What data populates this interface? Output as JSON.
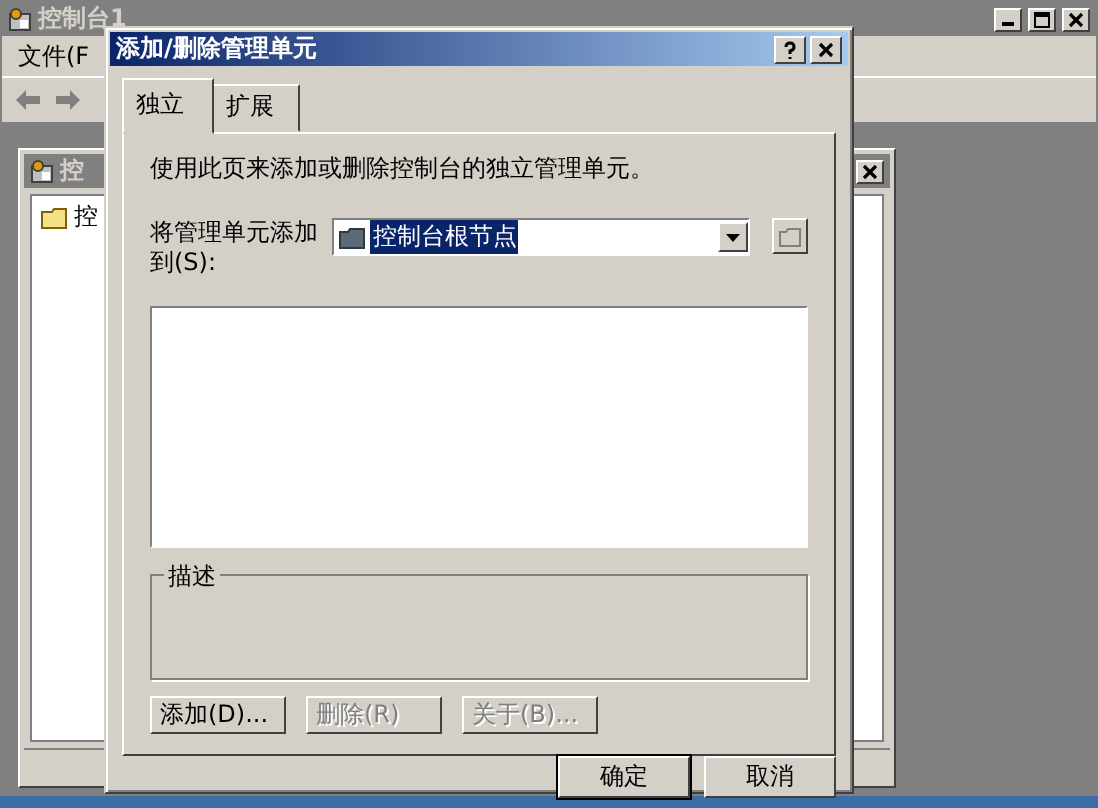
{
  "background_window": {
    "title": "控制台1",
    "menu": [
      {
        "label": "文件(F"
      }
    ],
    "child_window": {
      "title": "控",
      "tree": [
        {
          "label": "控"
        }
      ]
    }
  },
  "dialog": {
    "title": "添加/删除管理单元",
    "tabs": [
      {
        "label": "独立",
        "selected": true
      },
      {
        "label": "扩展",
        "selected": false
      }
    ],
    "description": "使用此页来添加或删除控制台的独立管理单元。",
    "add_to_label": "将管理单元添加到(S):",
    "add_to_value": "控制台根节点",
    "group_title": "描述",
    "buttons": [
      {
        "label": "添加(D)...",
        "disabled": false
      },
      {
        "label": "删除(R)",
        "disabled": true
      },
      {
        "label": "关于(B)...",
        "disabled": true
      }
    ],
    "footer_buttons": [
      {
        "label": "确定",
        "default": true
      },
      {
        "label": "取消",
        "default": false
      }
    ]
  }
}
